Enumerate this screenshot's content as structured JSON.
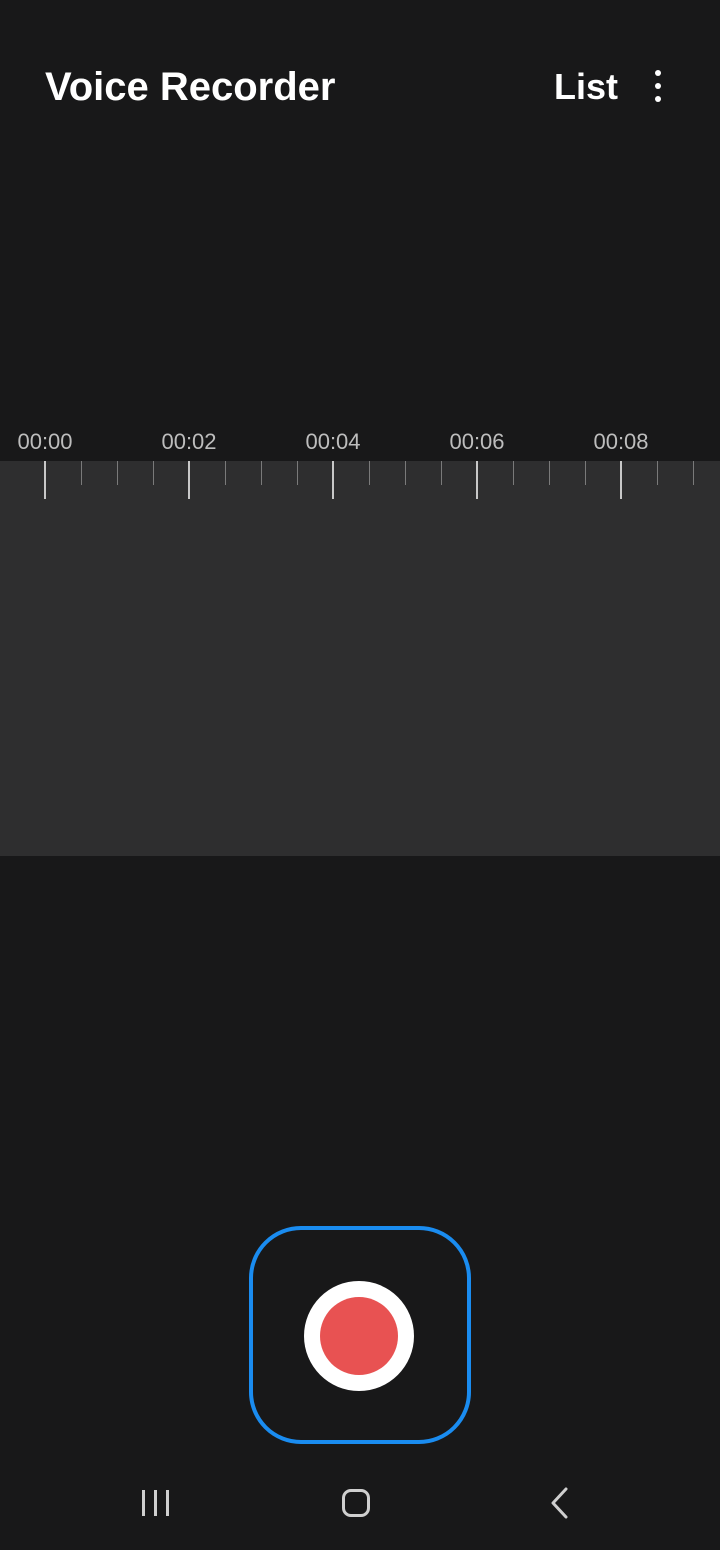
{
  "header": {
    "title": "Voice Recorder",
    "list_label": "List",
    "more_icon": "more-vertical-icon"
  },
  "timeline": {
    "labels": [
      "00:00",
      "00:02",
      "00:04",
      "00:06",
      "00:08"
    ]
  },
  "record": {
    "icon": "record-icon",
    "accent_color": "#1a8cf0",
    "record_color": "#e85252"
  },
  "navbar": {
    "recents_icon": "recents-icon",
    "home_icon": "home-icon",
    "back_icon": "back-icon"
  }
}
